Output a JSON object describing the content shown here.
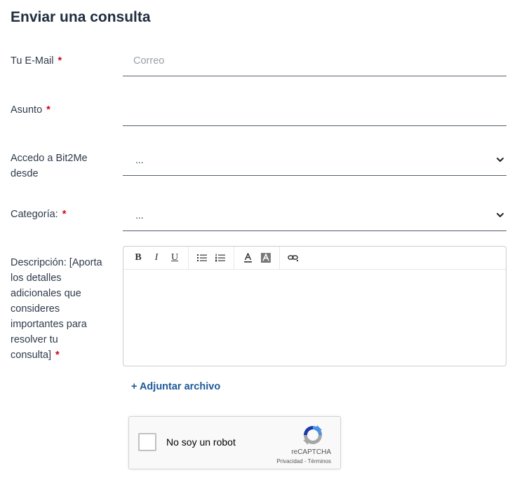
{
  "form": {
    "title": "Enviar una consulta",
    "email": {
      "label": "Tu E-Mail",
      "placeholder": "Correo",
      "value": "",
      "required_mark": "*"
    },
    "subject": {
      "label": "Asunto",
      "value": "",
      "required_mark": "*"
    },
    "access": {
      "label_line1": "Accedo a Bit2Me",
      "label_line2": "desde",
      "selected": "..."
    },
    "category": {
      "label": "Categoría:",
      "selected": "...",
      "required_mark": "*"
    },
    "description": {
      "label_lines": [
        "Descripción: [Aporta",
        "los detalles",
        "adicionales que",
        "consideres",
        "importantes para",
        "resolver tu",
        "consulta]"
      ],
      "required_mark": "*",
      "toolbar": {
        "bold": "B",
        "italic": "I",
        "underline": "U",
        "icons": [
          "bulleted-list-icon",
          "numbered-list-icon",
          "font-color-icon",
          "highlight-color-icon",
          "link-icon"
        ]
      }
    },
    "attach_label": "+ Adjuntar archivo",
    "captcha": {
      "label": "No soy un robot",
      "brand": "reCAPTCHA",
      "privacy": "Privacidad",
      "separator": "-",
      "terms": "Términos"
    }
  },
  "colors": {
    "required": "#d0021b",
    "link": "#1d5a9a",
    "title": "#1f2d3d"
  }
}
